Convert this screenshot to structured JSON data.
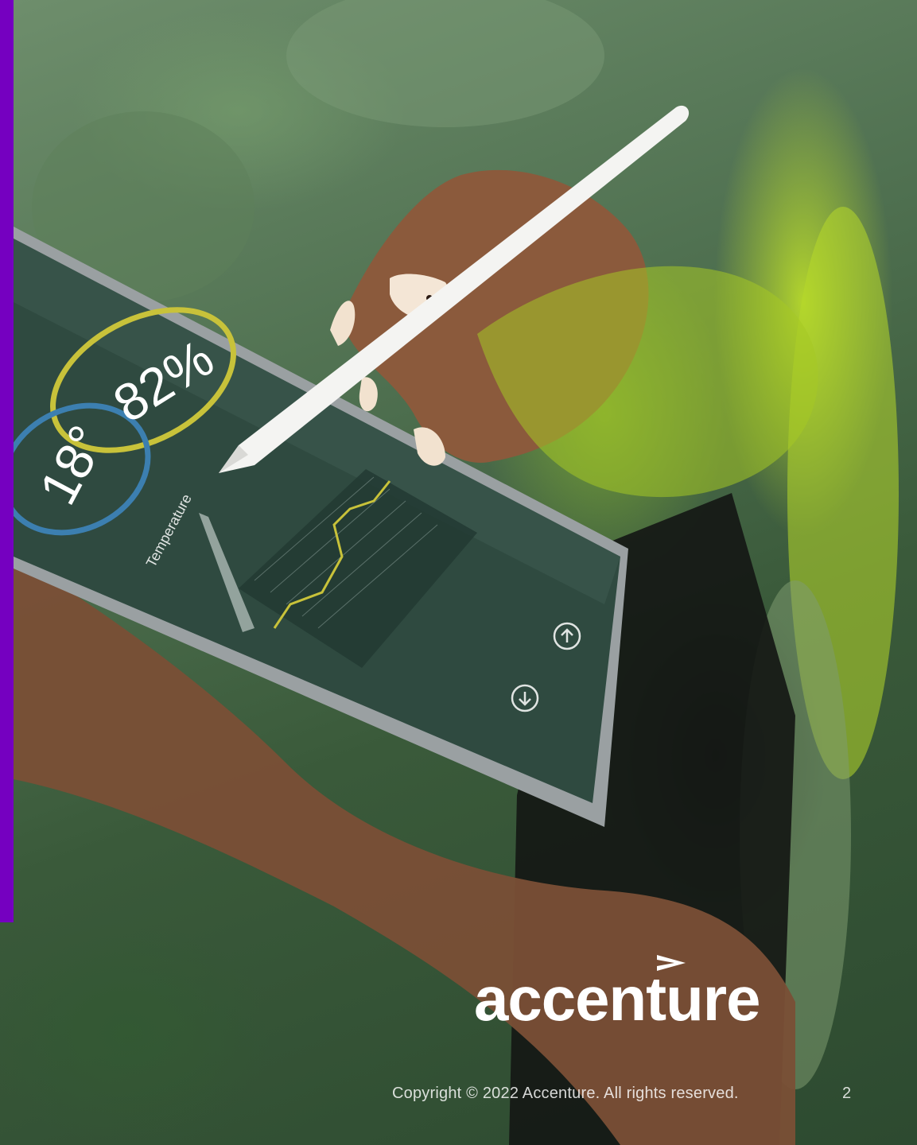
{
  "slide": {
    "accent_color": "#7500c0",
    "brand": "accenture",
    "copyright": "Copyright © 2022 Accenture. All rights reserved.",
    "page_number": "2"
  },
  "photo": {
    "tablet_readouts": {
      "humidity": "82%",
      "temperature_value": "18°",
      "temperature_label": "Temperature"
    },
    "icons": [
      "upload-icon",
      "download-icon"
    ]
  }
}
